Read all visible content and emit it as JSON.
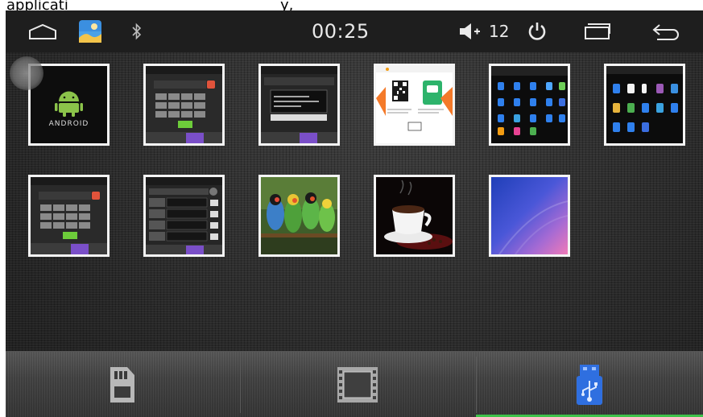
{
  "top_strip": {
    "left_fragment": "applicati",
    "right_fragment": "y,"
  },
  "status_bar": {
    "icons": [
      "home-icon",
      "gallery-app-icon",
      "bluetooth-icon",
      "volume-icon",
      "power-icon",
      "recent-apps-icon",
      "back-icon"
    ],
    "time": "00:25",
    "volume_level": "12"
  },
  "gallery": {
    "thumbnails": [
      {
        "name": "android-logo-image",
        "kind": "android",
        "text": "ANDROID"
      },
      {
        "name": "phone-dialer-screenshot",
        "kind": "dialer"
      },
      {
        "name": "settings-screenshot",
        "kind": "settings"
      },
      {
        "name": "qr-code-screenshot",
        "kind": "qr"
      },
      {
        "name": "app-icons-screenshot-1",
        "kind": "icons"
      },
      {
        "name": "app-icons-screenshot-2",
        "kind": "icons2"
      },
      {
        "name": "phone-dialer-screenshot-2",
        "kind": "dialer"
      },
      {
        "name": "settings-list-screenshot",
        "kind": "list"
      },
      {
        "name": "parrots-photo",
        "kind": "parrots"
      },
      {
        "name": "coffee-cup-photo",
        "kind": "coffee"
      },
      {
        "name": "blue-pink-wallpaper",
        "kind": "wallpaper"
      }
    ]
  },
  "bottom_tabs": [
    {
      "name": "sd-card-tab",
      "icon": "sd-card-icon",
      "active": false
    },
    {
      "name": "video-tab",
      "icon": "film-icon",
      "active": false
    },
    {
      "name": "usb-tab",
      "icon": "usb-icon",
      "active": true
    }
  ],
  "colors": {
    "background": "#272727",
    "thumbnail_border": "#f4f4f4",
    "active_tab": "#3ec24a",
    "usb_icon": "#2f6fe0"
  }
}
